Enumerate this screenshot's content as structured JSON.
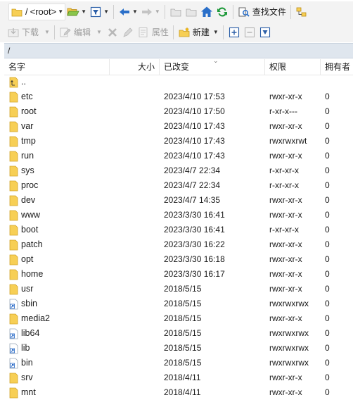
{
  "toolbar1": {
    "path_combo": {
      "slash": "/",
      "value": "<root>"
    },
    "find_files_label": "查找文件"
  },
  "toolbar2": {
    "download_label": "下载",
    "edit_label": "编辑",
    "properties_label": "属性",
    "new_label": "新建"
  },
  "address_path": "/",
  "columns": {
    "name": "名字",
    "size": "大小",
    "modified": "已改变",
    "rights": "权限",
    "owner": "拥有者"
  },
  "rows": [
    {
      "name": "..",
      "type": "parent",
      "date": "",
      "rights": "",
      "owner": ""
    },
    {
      "name": "etc",
      "type": "folder",
      "date": "2023/4/10 17:53",
      "rights": "rwxr-xr-x",
      "owner": "0"
    },
    {
      "name": "root",
      "type": "folder",
      "date": "2023/4/10 17:50",
      "rights": "r-xr-x---",
      "owner": "0"
    },
    {
      "name": "var",
      "type": "folder",
      "date": "2023/4/10 17:43",
      "rights": "rwxr-xr-x",
      "owner": "0"
    },
    {
      "name": "tmp",
      "type": "folder",
      "date": "2023/4/10 17:43",
      "rights": "rwxrwxrwt",
      "owner": "0"
    },
    {
      "name": "run",
      "type": "folder",
      "date": "2023/4/10 17:43",
      "rights": "rwxr-xr-x",
      "owner": "0"
    },
    {
      "name": "sys",
      "type": "folder",
      "date": "2023/4/7 22:34",
      "rights": "r-xr-xr-x",
      "owner": "0"
    },
    {
      "name": "proc",
      "type": "folder",
      "date": "2023/4/7 22:34",
      "rights": "r-xr-xr-x",
      "owner": "0"
    },
    {
      "name": "dev",
      "type": "folder",
      "date": "2023/4/7 14:35",
      "rights": "rwxr-xr-x",
      "owner": "0"
    },
    {
      "name": "www",
      "type": "folder",
      "date": "2023/3/30 16:41",
      "rights": "rwxr-xr-x",
      "owner": "0"
    },
    {
      "name": "boot",
      "type": "folder",
      "date": "2023/3/30 16:41",
      "rights": "r-xr-xr-x",
      "owner": "0"
    },
    {
      "name": "patch",
      "type": "folder",
      "date": "2023/3/30 16:22",
      "rights": "rwxr-xr-x",
      "owner": "0"
    },
    {
      "name": "opt",
      "type": "folder",
      "date": "2023/3/30 16:18",
      "rights": "rwxr-xr-x",
      "owner": "0"
    },
    {
      "name": "home",
      "type": "folder",
      "date": "2023/3/30 16:17",
      "rights": "rwxr-xr-x",
      "owner": "0"
    },
    {
      "name": "usr",
      "type": "folder",
      "date": "2018/5/15",
      "rights": "rwxr-xr-x",
      "owner": "0"
    },
    {
      "name": "sbin",
      "type": "link",
      "date": "2018/5/15",
      "rights": "rwxrwxrwx",
      "owner": "0"
    },
    {
      "name": "media2",
      "type": "folder",
      "date": "2018/5/15",
      "rights": "rwxr-xr-x",
      "owner": "0"
    },
    {
      "name": "lib64",
      "type": "link",
      "date": "2018/5/15",
      "rights": "rwxrwxrwx",
      "owner": "0"
    },
    {
      "name": "lib",
      "type": "link",
      "date": "2018/5/15",
      "rights": "rwxrwxrwx",
      "owner": "0"
    },
    {
      "name": "bin",
      "type": "link",
      "date": "2018/5/15",
      "rights": "rwxrwxrwx",
      "owner": "0"
    },
    {
      "name": "srv",
      "type": "folder",
      "date": "2018/4/11",
      "rights": "rwxr-xr-x",
      "owner": "0"
    },
    {
      "name": "mnt",
      "type": "folder",
      "date": "2018/4/11",
      "rights": "rwxr-xr-x",
      "owner": "0"
    }
  ],
  "colors": {
    "folder": "#f7cf55",
    "link_arrow": "#1e63c5",
    "address_bar": "#dfe6ee",
    "refresh": "#1f9a3b",
    "home": "#2a6fc9"
  }
}
